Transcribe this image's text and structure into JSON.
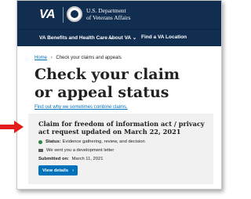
{
  "header": {
    "logo": "VA",
    "dept_line1": "U.S. Department",
    "dept_line2": "of Veterans Affairs"
  },
  "nav": {
    "items": [
      {
        "label": "VA Benefits and Health Care",
        "chevron": "⌄"
      },
      {
        "label": "About VA",
        "chevron": "⌄"
      },
      {
        "label": "Find a VA Location",
        "chevron": ""
      }
    ]
  },
  "breadcrumb": {
    "home": "Home",
    "separator": "›",
    "current": "Check your claims and appeals"
  },
  "page": {
    "title": "Check your claim or appeal status",
    "combine_link": "Find out why we sometimes combine claims."
  },
  "claim_card": {
    "title": "Claim for freedom of information act / privacy act request updated on March 22, 2021",
    "status_label": "Status:",
    "status_value": "Evidence gathering, review, and decision",
    "letter_text": "We sent you a development letter",
    "submitted_label": "Submitted on:",
    "submitted_value": "March 11, 2021",
    "button_label": "View details",
    "button_chevron": "›"
  },
  "colors": {
    "header_bg": "#112e51",
    "link": "#0071bb",
    "card_bg": "#f1f1f1",
    "status_green": "#2e8540",
    "annotation_red": "#e31c1c"
  },
  "icons": [
    "va-seal-icon",
    "chevron-down-icon",
    "status-dot-icon",
    "mail-icon",
    "chevron-right-icon",
    "red-arrow-icon"
  ]
}
